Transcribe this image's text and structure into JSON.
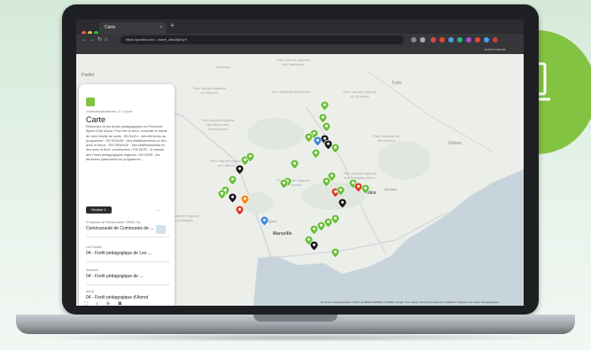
{
  "browser": {
    "tab_title": "Carte",
    "tab_close": "×",
    "new_tab": "+",
    "url": "https://padlet.com/.../carte_abs2bjf1ynf",
    "bookmark": "Autres favoris"
  },
  "map": {
    "labels": {
      "grenoble": "Grenoble",
      "parc_vercors": "Parc naturel régional du Vercors",
      "parc_ecrins": "Parc National des Écrins",
      "parc_queyras": "Parc naturel régional du Queyras",
      "parc_chartreuse": "Parc naturel régional de Chartreuse",
      "parc_baronnies": "Parc naturel régional des Baronnies Provençales",
      "parc_verdon": "Parc naturel régional du Verdon",
      "parc_luberon": "Parc naturel régional du Luberon",
      "parc_prealpes": "Parc naturel régional des Préalpes d'Azur",
      "parc_mercantour": "Parc National du Mercantour",
      "parc_camargue": "Parc naturel régional de Camargue",
      "turin": "Turin",
      "genes": "Gênes",
      "nice": "Nice",
      "marseille": "Marseille",
      "monaco": "Monaco",
      "avignon": "Avignon"
    },
    "attribution": "Données cartographiques ©2024 GeoBasis-DE/BKG (©2009), Google, Inst. Geogr. Nacional   Conditions d'utilisation   Signaler une erreur cartographique",
    "fab_plus": "+"
  },
  "panel": {
    "app_name": "Padlet",
    "breadcrumb": "communicationterrars • 1 • 3 jours",
    "title": "Carte",
    "description": "Retrouvez ici les fiches pédagogiques en Provence-Alpes-Côte d'Azur. Pour lire la fiche, consulter le détail de votre feuille de route : EN BLEU : des éléments du programme ; EN ROUGE : des établissements en lien avec la faune ; EN ORANGE : des établissements en lien avec la flore, construction / EN VERT : le réseau des Parcs pédagogiques régional / EN NOIR : les territoires partenaires du programme...",
    "section_label": "Section 1",
    "section_meta": "⋯  +",
    "items": [
      {
        "cat": "4 Impasse de l'Observatoire, 05000 Ga...",
        "title": "Communauté de Communes de ..."
      },
      {
        "cat": "Les Thuiles",
        "title": "04 - Forêt pédagogique de Les ..."
      },
      {
        "cat": "Selonnet",
        "title": "04 - Forêt pédagogique de ..."
      },
      {
        "cat": "Annot",
        "title": "04 - Forêt pédagogique d'Annot"
      }
    ],
    "tools": "⛶ ⌕ ⊕ ▦"
  },
  "colors": {
    "brand_green": "#82c341",
    "pin_green": "#6cbf3c",
    "pin_black": "#1b1b1b",
    "pin_red": "#d9402b",
    "pin_orange": "#f08a1c",
    "pin_blue": "#3f88d8",
    "sea": "#c7d4dc"
  },
  "icons": [
    "laptop-icon",
    "map-pin-icon",
    "plus-icon",
    "close-icon",
    "back-icon",
    "forward-icon",
    "reload-icon"
  ]
}
